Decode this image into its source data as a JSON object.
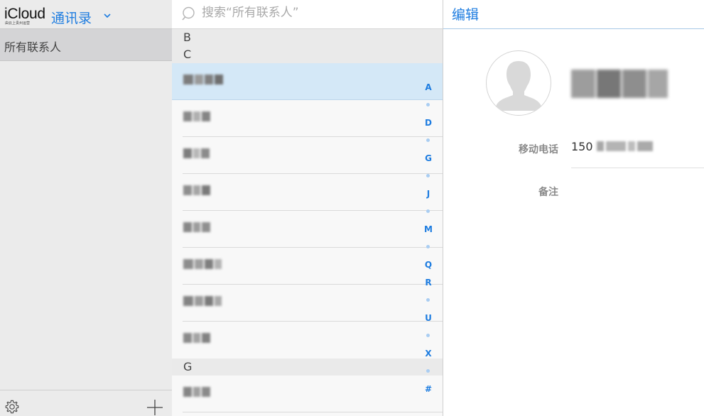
{
  "sidebar": {
    "brand": "iCloud",
    "brand_sub": "由云上贵州运营",
    "app_title": "通讯录",
    "groups": [
      {
        "label": "所有联系人",
        "selected": true
      }
    ],
    "footer": {
      "settings_icon": "gear-icon",
      "add_icon": "plus-icon"
    }
  },
  "list": {
    "search": {
      "placeholder": "搜索“所有联系人”",
      "value": "",
      "icon": "search-icon"
    },
    "sections": [
      {
        "letter": "B",
        "contacts": []
      },
      {
        "letter": "C",
        "contacts": [
          {
            "name": "(blurred)",
            "selected": true
          },
          {
            "name": "(blurred)"
          },
          {
            "name": "(blurred)"
          },
          {
            "name": "(blurred)"
          },
          {
            "name": "(blurred)"
          },
          {
            "name": "(blurred)"
          },
          {
            "name": "(blurred)"
          },
          {
            "name": "(blurred)"
          }
        ]
      },
      {
        "letter": "G",
        "contacts": [
          {
            "name": "(blurred)"
          }
        ]
      }
    ],
    "index": [
      "A",
      "D",
      "G",
      "J",
      "M",
      "Q",
      "R",
      "U",
      "X",
      "#"
    ]
  },
  "detail": {
    "edit_label": "编辑",
    "avatar_icon": "person-silhouette-icon",
    "contact_name": "(blurred)",
    "fields": [
      {
        "label": "移动电话",
        "value_visible": "150",
        "value_blurred": true
      },
      {
        "label": "备注",
        "value_visible": ""
      }
    ]
  },
  "colors": {
    "accent": "#1d7ce0",
    "selected_row": "#d4e8f7",
    "sidebar_bg": "#ebebeb",
    "sidebar_selected": "#d4d4d6",
    "index_dot": "#a9cdf2"
  }
}
